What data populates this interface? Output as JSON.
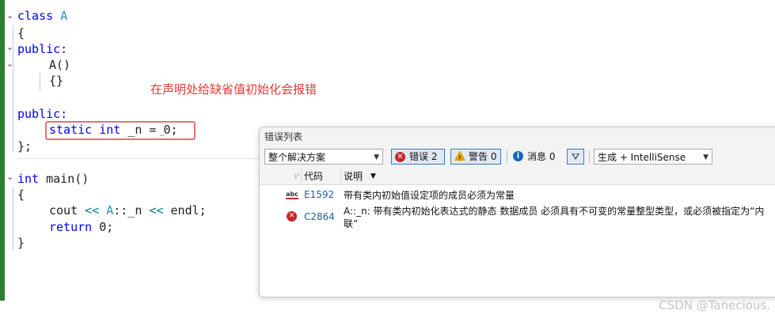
{
  "editor": {
    "lines": {
      "l1": {
        "kw": "class",
        "name": "A"
      },
      "l2": "{",
      "l3": "public:",
      "l4": "A()",
      "l5": "{}",
      "l7": "public:",
      "l8": {
        "static": "static",
        "int": "int",
        "rest": "_n = 0;"
      },
      "l9": "};",
      "l10": {
        "int": "int",
        "rest": "main()"
      },
      "l11": "{",
      "l12": {
        "a": "cout",
        "op1": "<<",
        "cls": "A",
        "b": "::_n",
        "op2": "<<",
        "c": "endl;"
      },
      "l13": {
        "kw": "return",
        "rest": "0;"
      },
      "l14": "}"
    },
    "fold_glyph": "⌄",
    "annotation": "在声明处给缺省值初始化会报错"
  },
  "error_panel": {
    "title": "错误列表",
    "scope_select": "整个解决方案",
    "errors_label": "错误 2",
    "warnings_label": "警告 0",
    "messages_label": "消息 0",
    "build_select": "生成 + IntelliSense",
    "headers": {
      "code": "代码",
      "desc": "说明"
    },
    "rows": [
      {
        "code": "E1592",
        "desc": "带有类内初始值设定项的成员必须为常量"
      },
      {
        "code": "C2864",
        "desc": "A::_n: 带有类内初始化表达式的静态 数据成员 必须具有不可变的常量整型类型，或必须被指定为“内联”"
      }
    ]
  },
  "watermark": "CSDN @Tanecious."
}
